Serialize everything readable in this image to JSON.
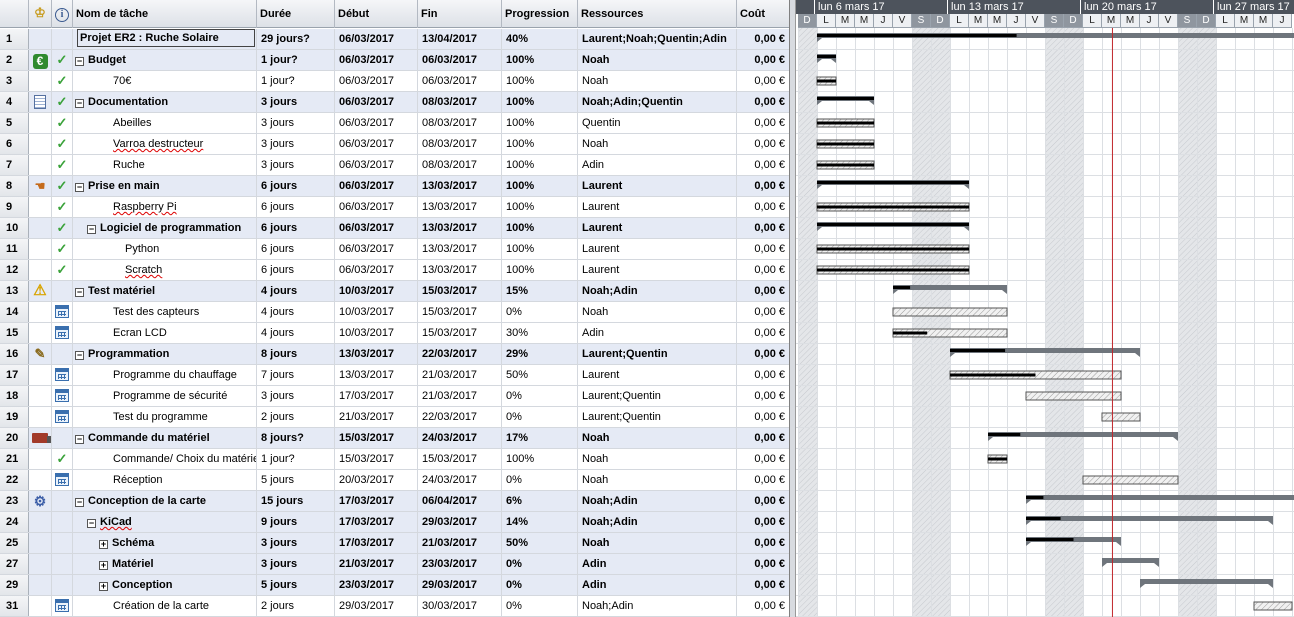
{
  "columns": {
    "name": "Nom de tâche",
    "duration": "Durée",
    "start": "Début",
    "end": "Fin",
    "progress": "Progression",
    "resources": "Ressources",
    "cost": "Coût"
  },
  "header_icons": [
    "crown-icon",
    "info-icon"
  ],
  "tasks": [
    {
      "id": "1",
      "name": "Projet ER2 : Ruche Solaire",
      "level": 0,
      "summary": true,
      "boxed": true,
      "duration": "29 jours?",
      "start": "06/03/2017",
      "end": "13/04/2017",
      "progress": "40%",
      "resources": "Laurent;Noah;Quentin;Adin",
      "cost": "0,00 €",
      "indicator": "",
      "info": "",
      "expand": "",
      "wavy": false
    },
    {
      "id": "2",
      "name": "Budget",
      "level": 0,
      "summary": true,
      "duration": "1 jour?",
      "start": "06/03/2017",
      "end": "06/03/2017",
      "progress": "100%",
      "resources": "Noah",
      "cost": "0,00 €",
      "indicator": "euro",
      "info": "check",
      "expand": "−",
      "wavy": false
    },
    {
      "id": "3",
      "name": "70€",
      "level": 2,
      "summary": false,
      "duration": "1 jour?",
      "start": "06/03/2017",
      "end": "06/03/2017",
      "progress": "100%",
      "resources": "Noah",
      "cost": "0,00 €",
      "indicator": "",
      "info": "check",
      "expand": "",
      "wavy": false
    },
    {
      "id": "4",
      "name": "Documentation",
      "level": 0,
      "summary": true,
      "duration": "3 jours",
      "start": "06/03/2017",
      "end": "08/03/2017",
      "progress": "100%",
      "resources": "Noah;Adin;Quentin",
      "cost": "0,00 €",
      "indicator": "notes",
      "info": "check",
      "expand": "−",
      "wavy": false
    },
    {
      "id": "5",
      "name": "Abeilles",
      "level": 2,
      "summary": false,
      "duration": "3 jours",
      "start": "06/03/2017",
      "end": "08/03/2017",
      "progress": "100%",
      "resources": "Quentin",
      "cost": "0,00 €",
      "indicator": "",
      "info": "check",
      "expand": "",
      "wavy": false
    },
    {
      "id": "6",
      "name": "Varroa destructeur",
      "level": 2,
      "summary": false,
      "duration": "3 jours",
      "start": "06/03/2017",
      "end": "08/03/2017",
      "progress": "100%",
      "resources": "Noah",
      "cost": "0,00 €",
      "indicator": "",
      "info": "check",
      "expand": "",
      "wavy": true
    },
    {
      "id": "7",
      "name": "Ruche",
      "level": 2,
      "summary": false,
      "duration": "3 jours",
      "start": "06/03/2017",
      "end": "08/03/2017",
      "progress": "100%",
      "resources": "Adin",
      "cost": "0,00 €",
      "indicator": "",
      "info": "check",
      "expand": "",
      "wavy": false
    },
    {
      "id": "8",
      "name": "Prise en main",
      "level": 0,
      "summary": true,
      "duration": "6 jours",
      "start": "06/03/2017",
      "end": "13/03/2017",
      "progress": "100%",
      "resources": "Laurent",
      "cost": "0,00 €",
      "indicator": "hand",
      "info": "check",
      "expand": "−",
      "wavy": false
    },
    {
      "id": "9",
      "name": "Raspberry Pi",
      "level": 2,
      "summary": false,
      "duration": "6 jours",
      "start": "06/03/2017",
      "end": "13/03/2017",
      "progress": "100%",
      "resources": "Laurent",
      "cost": "0,00 €",
      "indicator": "",
      "info": "check",
      "expand": "",
      "wavy": true
    },
    {
      "id": "10",
      "name": "Logiciel de programmation",
      "level": 1,
      "summary": true,
      "duration": "6 jours",
      "start": "06/03/2017",
      "end": "13/03/2017",
      "progress": "100%",
      "resources": "Laurent",
      "cost": "0,00 €",
      "indicator": "",
      "info": "check",
      "expand": "−",
      "wavy": false
    },
    {
      "id": "11",
      "name": "Python",
      "level": 3,
      "summary": false,
      "duration": "6 jours",
      "start": "06/03/2017",
      "end": "13/03/2017",
      "progress": "100%",
      "resources": "Laurent",
      "cost": "0,00 €",
      "indicator": "",
      "info": "check",
      "expand": "",
      "wavy": false
    },
    {
      "id": "12",
      "name": "Scratch",
      "level": 3,
      "summary": false,
      "duration": "6 jours",
      "start": "06/03/2017",
      "end": "13/03/2017",
      "progress": "100%",
      "resources": "Laurent",
      "cost": "0,00 €",
      "indicator": "",
      "info": "check",
      "expand": "",
      "wavy": true
    },
    {
      "id": "13",
      "name": "Test matériel",
      "level": 0,
      "summary": true,
      "duration": "4 jours",
      "start": "10/03/2017",
      "end": "15/03/2017",
      "progress": "15%",
      "resources": "Noah;Adin",
      "cost": "0,00 €",
      "indicator": "warn",
      "info": "",
      "expand": "−",
      "wavy": false
    },
    {
      "id": "14",
      "name": "Test des capteurs",
      "level": 2,
      "summary": false,
      "duration": "4 jours",
      "start": "10/03/2017",
      "end": "15/03/2017",
      "progress": "0%",
      "resources": "Noah",
      "cost": "0,00 €",
      "indicator": "",
      "info": "cal",
      "expand": "",
      "wavy": false
    },
    {
      "id": "15",
      "name": "Ecran LCD",
      "level": 2,
      "summary": false,
      "duration": "4 jours",
      "start": "10/03/2017",
      "end": "15/03/2017",
      "progress": "30%",
      "resources": "Adin",
      "cost": "0,00 €",
      "indicator": "",
      "info": "cal",
      "expand": "",
      "wavy": false
    },
    {
      "id": "16",
      "name": "Programmation",
      "level": 0,
      "summary": true,
      "duration": "8 jours",
      "start": "13/03/2017",
      "end": "22/03/2017",
      "progress": "29%",
      "resources": "Laurent;Quentin",
      "cost": "0,00 €",
      "indicator": "pencil",
      "info": "",
      "expand": "−",
      "wavy": false
    },
    {
      "id": "17",
      "name": "Programme du chauffage",
      "level": 2,
      "summary": false,
      "duration": "7 jours",
      "start": "13/03/2017",
      "end": "21/03/2017",
      "progress": "50%",
      "resources": "Laurent",
      "cost": "0,00 €",
      "indicator": "",
      "info": "cal",
      "expand": "",
      "wavy": false
    },
    {
      "id": "18",
      "name": "Programme de sécurité",
      "level": 2,
      "summary": false,
      "duration": "3 jours",
      "start": "17/03/2017",
      "end": "21/03/2017",
      "progress": "0%",
      "resources": "Laurent;Quentin",
      "cost": "0,00 €",
      "indicator": "",
      "info": "cal",
      "expand": "",
      "wavy": false
    },
    {
      "id": "19",
      "name": "Test du programme",
      "level": 2,
      "summary": false,
      "duration": "2 jours",
      "start": "21/03/2017",
      "end": "22/03/2017",
      "progress": "0%",
      "resources": "Laurent;Quentin",
      "cost": "0,00 €",
      "indicator": "",
      "info": "cal",
      "expand": "",
      "wavy": false
    },
    {
      "id": "20",
      "name": "Commande du matériel",
      "level": 0,
      "summary": true,
      "duration": "8 jours?",
      "start": "15/03/2017",
      "end": "24/03/2017",
      "progress": "17%",
      "resources": "Noah",
      "cost": "0,00 €",
      "indicator": "truck",
      "info": "",
      "expand": "−",
      "wavy": false
    },
    {
      "id": "21",
      "name": "Commande/ Choix du matériel",
      "level": 2,
      "summary": false,
      "duration": "1 jour?",
      "start": "15/03/2017",
      "end": "15/03/2017",
      "progress": "100%",
      "resources": "Noah",
      "cost": "0,00 €",
      "indicator": "",
      "info": "check",
      "expand": "",
      "wavy": false
    },
    {
      "id": "22",
      "name": "Réception",
      "level": 2,
      "summary": false,
      "duration": "5 jours",
      "start": "20/03/2017",
      "end": "24/03/2017",
      "progress": "0%",
      "resources": "Noah",
      "cost": "0,00 €",
      "indicator": "",
      "info": "cal",
      "expand": "",
      "wavy": false
    },
    {
      "id": "23",
      "name": "Conception de la carte",
      "level": 0,
      "summary": true,
      "duration": "15 jours",
      "start": "17/03/2017",
      "end": "06/04/2017",
      "progress": "6%",
      "resources": "Noah;Adin",
      "cost": "0,00 €",
      "indicator": "gear",
      "info": "",
      "expand": "−",
      "wavy": false
    },
    {
      "id": "24",
      "name": "KiCad",
      "level": 1,
      "summary": true,
      "duration": "9 jours",
      "start": "17/03/2017",
      "end": "29/03/2017",
      "progress": "14%",
      "resources": "Noah;Adin",
      "cost": "0,00 €",
      "indicator": "",
      "info": "",
      "expand": "−",
      "wavy": true
    },
    {
      "id": "25",
      "name": "Schéma",
      "level": 2,
      "summary": true,
      "duration": "3 jours",
      "start": "17/03/2017",
      "end": "21/03/2017",
      "progress": "50%",
      "resources": "Noah",
      "cost": "0,00 €",
      "indicator": "",
      "info": "",
      "expand": "+",
      "wavy": false
    },
    {
      "id": "27",
      "name": "Matériel",
      "level": 2,
      "summary": true,
      "duration": "3 jours",
      "start": "21/03/2017",
      "end": "23/03/2017",
      "progress": "0%",
      "resources": "Adin",
      "cost": "0,00 €",
      "indicator": "",
      "info": "",
      "expand": "+",
      "wavy": false
    },
    {
      "id": "29",
      "name": "Conception",
      "level": 2,
      "summary": true,
      "duration": "5 jours",
      "start": "23/03/2017",
      "end": "29/03/2017",
      "progress": "0%",
      "resources": "Adin",
      "cost": "0,00 €",
      "indicator": "",
      "info": "",
      "expand": "+",
      "wavy": false
    },
    {
      "id": "31",
      "name": "Création de la carte",
      "level": 2,
      "summary": false,
      "duration": "2 jours",
      "start": "29/03/2017",
      "end": "30/03/2017",
      "progress": "0%",
      "resources": "Noah;Adin",
      "cost": "0,00 €",
      "indicator": "",
      "info": "cal",
      "expand": "",
      "wavy": false
    }
  ],
  "gantt": {
    "weeks": [
      "lun 6 mars 17",
      "lun 13 mars 17",
      "lun 20 mars 17",
      "lun 27 mars 17"
    ],
    "days": [
      "D",
      "L",
      "M",
      "M",
      "J",
      "V",
      "S",
      "D",
      "L",
      "M",
      "M",
      "J",
      "V",
      "S",
      "D",
      "L",
      "M",
      "M",
      "J",
      "V",
      "S",
      "D",
      "L",
      "M",
      "M",
      "J"
    ],
    "weekend_days": [
      "S",
      "D"
    ],
    "today": "21/03/2017",
    "colors": {
      "summary_bar": "#6f757c",
      "progress": "#000000",
      "task_fill": "#e7e7e7",
      "today_line": "#c0262b",
      "weekend": "#d6d9dd",
      "grid": "#dcdfe3"
    }
  }
}
